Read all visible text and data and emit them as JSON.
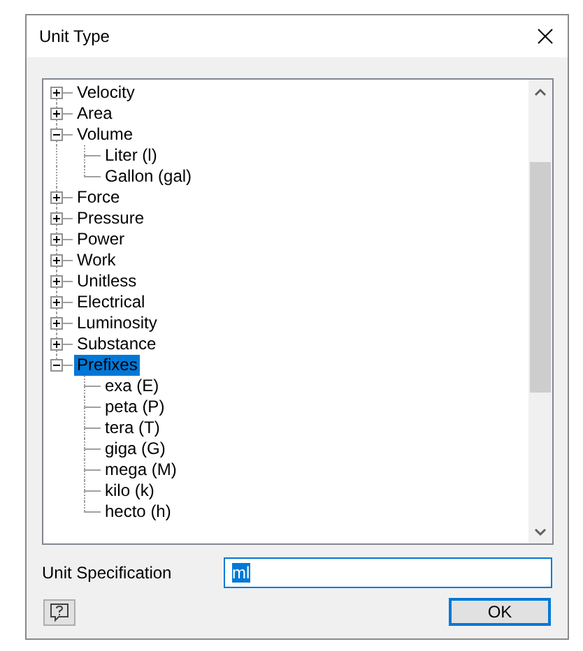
{
  "window": {
    "title": "Unit Type"
  },
  "tree": [
    {
      "label": "Velocity",
      "expanded": false,
      "selected": false
    },
    {
      "label": "Area",
      "expanded": false,
      "selected": false
    },
    {
      "label": "Volume",
      "expanded": true,
      "selected": false,
      "children": [
        {
          "label": "Liter (l)",
          "selected": false
        },
        {
          "label": "Gallon (gal)",
          "selected": false
        }
      ]
    },
    {
      "label": "Force",
      "expanded": false,
      "selected": false
    },
    {
      "label": "Pressure",
      "expanded": false,
      "selected": false
    },
    {
      "label": "Power",
      "expanded": false,
      "selected": false
    },
    {
      "label": "Work",
      "expanded": false,
      "selected": false
    },
    {
      "label": "Unitless",
      "expanded": false,
      "selected": false
    },
    {
      "label": "Electrical",
      "expanded": false,
      "selected": false
    },
    {
      "label": "Luminosity",
      "expanded": false,
      "selected": false
    },
    {
      "label": "Substance",
      "expanded": false,
      "selected": false
    },
    {
      "label": "Prefixes",
      "expanded": true,
      "selected": true,
      "children": [
        {
          "label": "exa (E)",
          "selected": false
        },
        {
          "label": "peta (P)",
          "selected": false
        },
        {
          "label": "tera (T)",
          "selected": false
        },
        {
          "label": "giga (G)",
          "selected": false
        },
        {
          "label": "mega (M)",
          "selected": false
        },
        {
          "label": "kilo (k)",
          "selected": false
        },
        {
          "label": "hecto (h)",
          "selected": false
        }
      ]
    }
  ],
  "unit_specification": {
    "label": "Unit Specification",
    "value": "ml",
    "value_selected": true
  },
  "buttons": [
    {
      "label": "OK",
      "default": true
    }
  ]
}
